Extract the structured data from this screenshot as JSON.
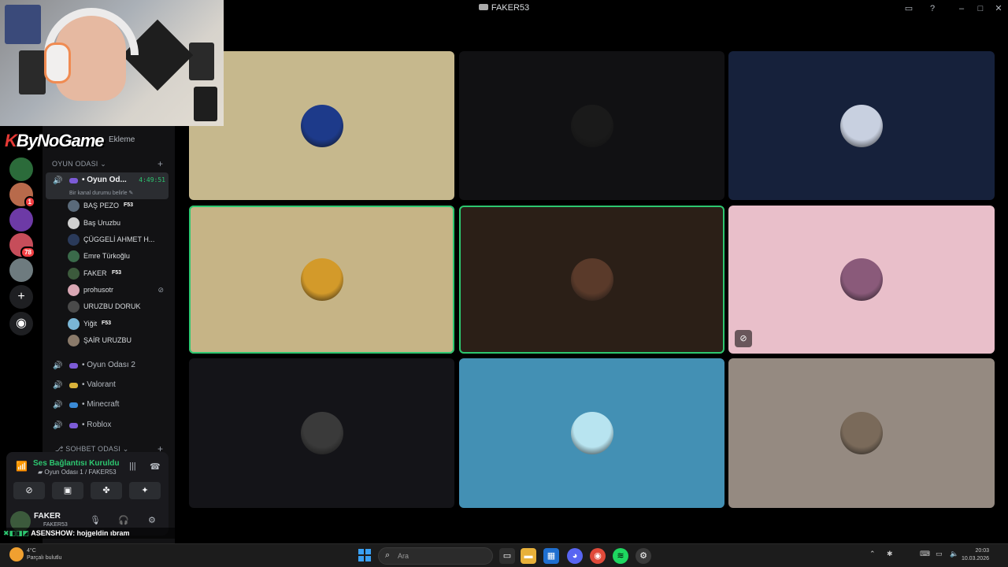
{
  "window": {
    "title": "FAKER53",
    "colors": {
      "background": "#000000",
      "speaking_ring": "#2dc770",
      "mention_badge": "#f23f43"
    }
  },
  "titlebar_icons": [
    "inbox-icon",
    "help-icon",
    "minimize-icon",
    "maximize-icon",
    "close-icon"
  ],
  "overlay": {
    "logo_prefix": "K",
    "logo_text": "ByNoGame",
    "ticker_user": "ASENSHOW",
    "ticker_message": ": hojgeldin ıbram",
    "header_hint": "Ekleme"
  },
  "servers": [
    {
      "name": "server-1",
      "color": "#2b6b3a"
    },
    {
      "name": "server-2",
      "color": "#b86a4b",
      "badge": "1"
    },
    {
      "name": "server-3",
      "color": "#6d3aa6"
    },
    {
      "name": "server-4",
      "color": "#c64d5a",
      "badge": "78"
    },
    {
      "name": "server-5",
      "color": "#6e7b7f"
    }
  ],
  "sidebar": {
    "category_voice": "OYUN ODASI",
    "category_text": "SOHBET ODASI",
    "active_channel": {
      "name": "• Oyun Od...",
      "timer": "4:49:51",
      "status": "Bir kanal durumu belirle ✎"
    },
    "members": [
      {
        "name": "BAŞ PEZO",
        "tag": "F53",
        "color": "#5a6a7a"
      },
      {
        "name": "Baş Uruzbu",
        "tag": "",
        "color": "#d0d0d0"
      },
      {
        "name": "ÇÜGGELİ AHMET H...",
        "tag": "",
        "color": "#2a3a5a"
      },
      {
        "name": "Emre Türkoğlu",
        "tag": "",
        "color": "#3a6a4a"
      },
      {
        "name": "FAKER",
        "tag": "F53",
        "color": "#3c5a3c"
      },
      {
        "name": "prohusotr",
        "tag": "",
        "color": "#d9a7b4",
        "muted": true
      },
      {
        "name": "URUZBU DORUK",
        "tag": "",
        "color": "#4a4a4a"
      },
      {
        "name": "Yiğit",
        "tag": "F53",
        "color": "#7ab6d6"
      },
      {
        "name": "ŞAİR URUZBU",
        "tag": "",
        "color": "#8a7a6a"
      }
    ],
    "other_channels": [
      {
        "name": "• Oyun Odası 2",
        "icon_color": "#7c5bd6"
      },
      {
        "name": "• Valorant",
        "icon_color": "#d9b23a"
      },
      {
        "name": "• Minecraft",
        "icon_color": "#3a8ad6"
      },
      {
        "name": "• Roblox",
        "icon_color": "#7c5bd6"
      }
    ]
  },
  "voice_panel": {
    "status": "Ses Bağlantısı Kuruldu",
    "location": "Oyun Odası 1 / FAKER53",
    "user_name": "FAKER",
    "user_tag": "FAKER53"
  },
  "grid": [
    {
      "bg": "#c6b88d",
      "avatar": "#1d3a8a",
      "speaking": false
    },
    {
      "bg": "#111113",
      "avatar": "#1a1a1a",
      "speaking": false
    },
    {
      "bg": "#16213b",
      "avatar": "#c8d0e0",
      "speaking": false
    },
    {
      "bg": "#c6b486",
      "avatar": "#d39a2a",
      "speaking": true
    },
    {
      "bg": "#2b1f17",
      "avatar": "#5a3a2a",
      "speaking": true
    },
    {
      "bg": "#e9bfca",
      "avatar": "#8a5a7a",
      "speaking": false,
      "muted": true
    },
    {
      "bg": "#141418",
      "avatar": "#3a3a3a",
      "speaking": false
    },
    {
      "bg": "#4390b4",
      "avatar": "#b8e4f0",
      "speaking": false
    },
    {
      "bg": "#958a81",
      "avatar": "#7a6a5a",
      "speaking": false
    }
  ],
  "taskbar": {
    "search_placeholder": "Ara",
    "weather_temp": "4°C",
    "weather_text": "Parçalı bulutlu",
    "clock_time": "20:03",
    "clock_date": "10.03.2026"
  }
}
